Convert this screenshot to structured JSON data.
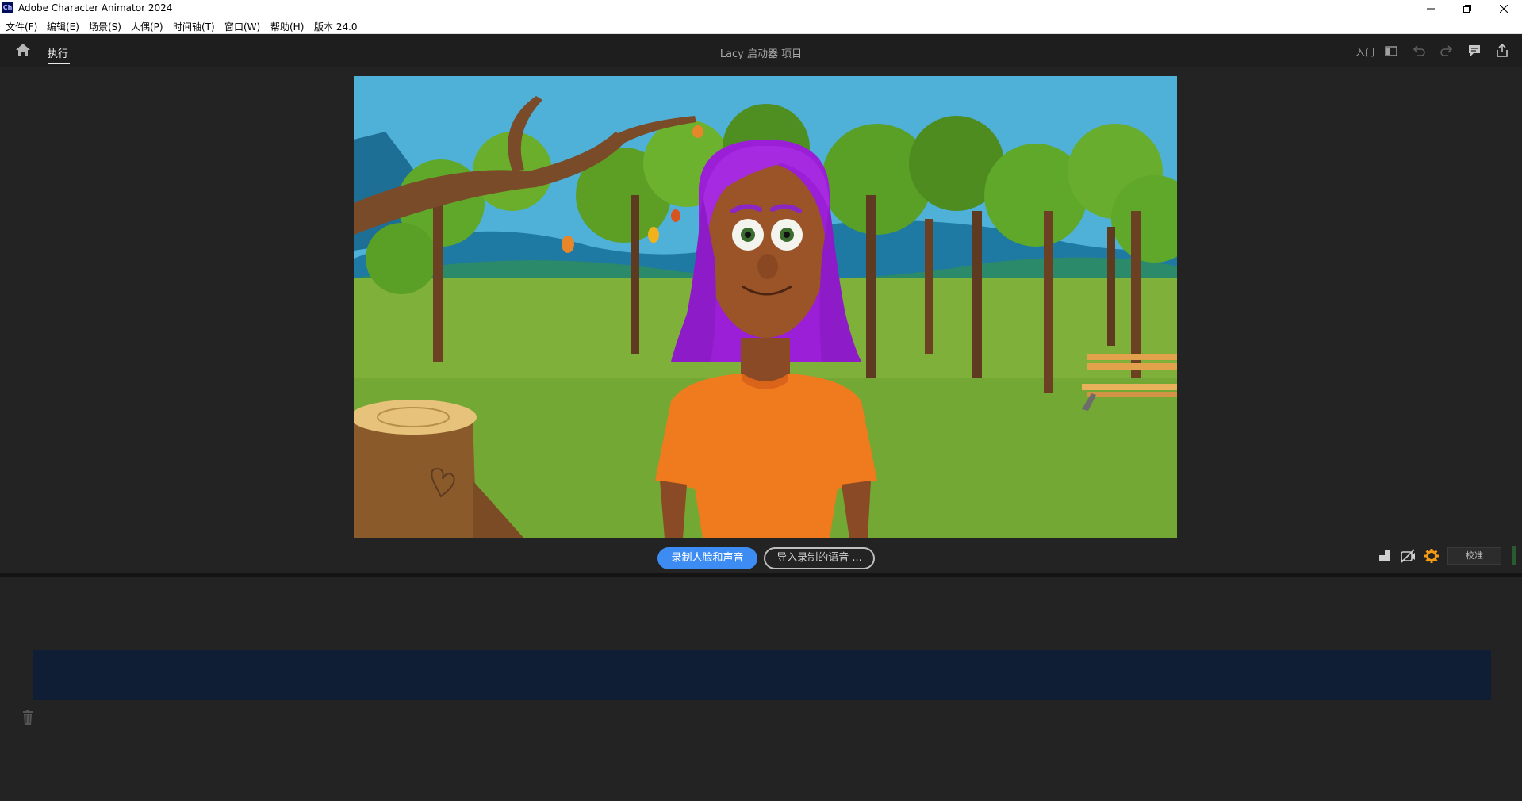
{
  "titlebar": {
    "icon_text": "Ch",
    "title": "Adobe Character Animator 2024",
    "controls": [
      "minimize-icon",
      "restore-icon",
      "close-icon"
    ]
  },
  "menubar": {
    "items": [
      {
        "label": "文件(F)"
      },
      {
        "label": "编辑(E)"
      },
      {
        "label": "场景(S)"
      },
      {
        "label": "人偶(P)"
      },
      {
        "label": "时间轴(T)"
      },
      {
        "label": "窗口(W)"
      },
      {
        "label": "帮助(H)"
      },
      {
        "label": "版本 24.0"
      }
    ]
  },
  "header": {
    "tabs": [
      {
        "label": "执行",
        "active": true
      }
    ],
    "project_title": "Lacy 启动器 项目",
    "intro_label": "入门",
    "icons": [
      "panel-layout-icon",
      "undo-icon",
      "redo-icon",
      "feedback-icon",
      "share-icon"
    ]
  },
  "scene": {
    "record_button": "录制人脸和声音",
    "import_button": "导入录制的语音 ...",
    "calibrate_button": "校准",
    "tool_icons": [
      "puppet-pin-icon",
      "camera-off-icon",
      "settings-gear-icon"
    ],
    "accent_color": "#3d8cf4",
    "gear_color": "#f59b14"
  },
  "timeline": {
    "track_color": "#0f1d35",
    "icons": [
      "trash-icon"
    ]
  }
}
